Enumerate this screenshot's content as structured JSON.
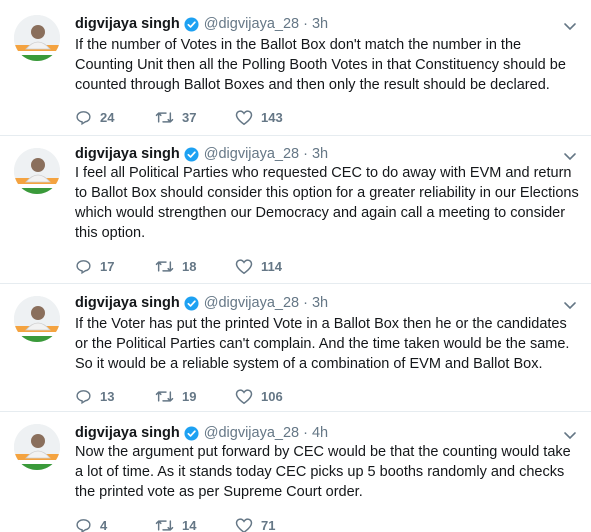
{
  "colors": {
    "verified": "#1da1f2",
    "secondary_text": "#657786",
    "divider": "#e6ecf0"
  },
  "icons": {
    "reply": "reply-icon",
    "retweet": "retweet-icon",
    "like": "heart-icon",
    "verified": "verified-badge-icon",
    "more": "chevron-down-icon"
  },
  "tweets": [
    {
      "name": "digvijaya singh",
      "handle": "@digvijaya_28",
      "dot": "·",
      "time": "3h",
      "text": "If the number of Votes in the Ballot Box don't match the number in the Counting Unit then all the Polling Booth Votes in that Constituency should be counted through Ballot Boxes and then only the result should be declared.",
      "replies": "24",
      "retweets": "37",
      "likes": "143"
    },
    {
      "name": "digvijaya singh",
      "handle": "@digvijaya_28",
      "dot": "·",
      "time": "3h",
      "text": "I feel all Political Parties who requested CEC to do away with EVM and return to Ballot Box should consider this option for a greater reliability in our Elections which would strengthen our Democracy and again call a meeting to consider this option.",
      "replies": "17",
      "retweets": "18",
      "likes": "114"
    },
    {
      "name": "digvijaya singh",
      "handle": "@digvijaya_28",
      "dot": "·",
      "time": "3h",
      "text": "If the Voter has put the printed Vote in a Ballot Box then he or the candidates or the Political Parties can't complain. And the time taken would be the same. So it would be a reliable system of a combination of EVM and Ballot Box.",
      "replies": "13",
      "retweets": "19",
      "likes": "106"
    },
    {
      "name": "digvijaya singh",
      "handle": "@digvijaya_28",
      "dot": "·",
      "time": "4h",
      "text": "Now the argument put forward by CEC would be that the counting would take a lot of time. As it stands today CEC picks up 5 booths randomly and checks the printed vote as per Supreme Court order.",
      "replies": "4",
      "retweets": "14",
      "likes": "71"
    }
  ]
}
